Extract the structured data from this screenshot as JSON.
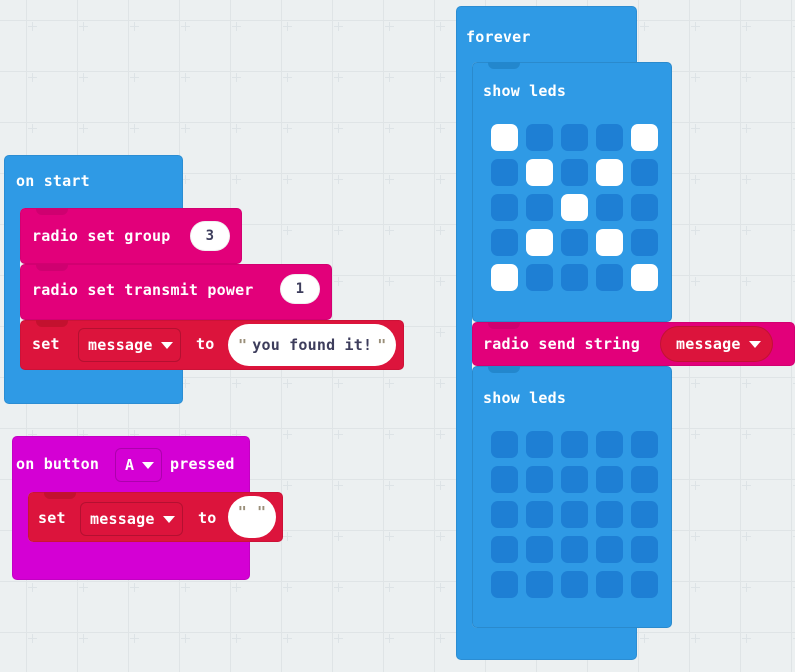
{
  "app": {
    "name": "MakeCode Blocks Editor",
    "canvas_background": "#ecf0f1",
    "grid_marker": "plus-grid"
  },
  "colors": {
    "event_blue": "#2f9ae5",
    "radio_magenta": "#e2007a",
    "variables_red": "#dc143c",
    "input_purple": "#d400d4",
    "basic_blue": "#2f9ae5",
    "led_off": "#1e7fd4",
    "led_on": "#ffffff",
    "field_white": "#ffffff",
    "field_text": "#3d3d5c"
  },
  "scripts": [
    {
      "id": "on-start-script",
      "hat": {
        "label": "on start",
        "category": "basic",
        "color": "#2f9ae5"
      },
      "statements": [
        {
          "id": "radio-set-group",
          "label": "radio set group",
          "category": "radio",
          "color": "#e2007a",
          "fields": [
            {
              "kind": "number",
              "name": "group",
              "value": "3"
            }
          ]
        },
        {
          "id": "radio-set-transmit-power",
          "label": "radio set transmit power",
          "category": "radio",
          "color": "#e2007a",
          "fields": [
            {
              "kind": "number",
              "name": "power",
              "value": "1"
            }
          ]
        },
        {
          "id": "set-variable-message-found",
          "label_before": "set",
          "label_after": "to",
          "category": "variables",
          "color": "#dc143c",
          "fields": [
            {
              "kind": "dropdown",
              "name": "variable",
              "value": "message"
            },
            {
              "kind": "string",
              "name": "value",
              "value": "you found it!",
              "quote": "\""
            }
          ]
        }
      ]
    },
    {
      "id": "on-button-pressed-script",
      "hat": {
        "label_before": "on button",
        "label_after": "pressed",
        "category": "input",
        "color": "#d400d4",
        "fields": [
          {
            "kind": "dropdown",
            "name": "button",
            "value": "A"
          }
        ]
      },
      "statements": [
        {
          "id": "set-variable-message-empty",
          "label_before": "set",
          "label_after": "to",
          "category": "variables",
          "color": "#dc143c",
          "fields": [
            {
              "kind": "dropdown",
              "name": "variable",
              "value": "message"
            },
            {
              "kind": "string",
              "name": "value",
              "value": "",
              "quote": "\""
            }
          ]
        }
      ]
    },
    {
      "id": "forever-script",
      "hat": {
        "label": "forever",
        "category": "basic",
        "color": "#2f9ae5"
      },
      "statements": [
        {
          "id": "show-leds-x",
          "label": "show leds",
          "category": "basic",
          "color": "#2f9ae5",
          "matrix": [
            [
              1,
              0,
              0,
              0,
              1
            ],
            [
              0,
              1,
              0,
              1,
              0
            ],
            [
              0,
              0,
              1,
              0,
              0
            ],
            [
              0,
              1,
              0,
              1,
              0
            ],
            [
              1,
              0,
              0,
              0,
              1
            ]
          ]
        },
        {
          "id": "radio-send-string",
          "label": "radio send string",
          "category": "radio",
          "color": "#e2007a",
          "fields": [
            {
              "kind": "dropdown",
              "name": "value",
              "value": "message"
            }
          ]
        },
        {
          "id": "show-leds-blank",
          "label": "show leds",
          "category": "basic",
          "color": "#2f9ae5",
          "matrix": [
            [
              0,
              0,
              0,
              0,
              0
            ],
            [
              0,
              0,
              0,
              0,
              0
            ],
            [
              0,
              0,
              0,
              0,
              0
            ],
            [
              0,
              0,
              0,
              0,
              0
            ],
            [
              0,
              0,
              0,
              0,
              0
            ]
          ]
        }
      ]
    }
  ]
}
